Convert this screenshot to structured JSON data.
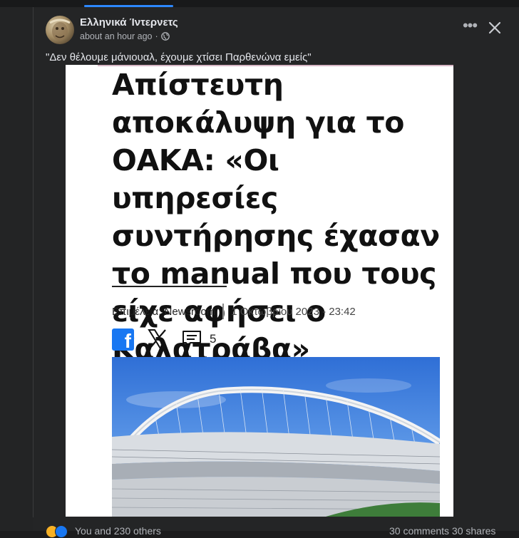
{
  "post": {
    "author": "Ελληνικά Ίντερνετς",
    "timestamp": "about an hour ago",
    "caption": "\"Δεν θέλουμε μάνιουαλ, έχουμε χτίσει Παρθενώνα εμείς\""
  },
  "article": {
    "headline": "Απίστευτη αποκάλυψη για το ΟΑΚΑ: «Οι υπηρεσίες συντήρησης έχασαν το manual που τους είχε αφήσει ο Καλατράβα»",
    "byline_author": "Επιμέλεια: Newsroom",
    "byline_date": "1 Οκτωβρίου 2023 - 23:42",
    "comments_count": "5"
  },
  "footer": {
    "reactions_text": "You and 230 others",
    "comments_shares": "30 comments  30 shares"
  },
  "icons": {
    "more": "more-options-icon",
    "close": "close-icon",
    "globe": "globe-icon",
    "facebook": "facebook-icon",
    "x": "x-icon",
    "comment": "comment-icon"
  },
  "colors": {
    "background": "#1c1c1d",
    "card": "#242526",
    "accent": "#2d88ff",
    "facebook_blue": "#1877f2"
  }
}
